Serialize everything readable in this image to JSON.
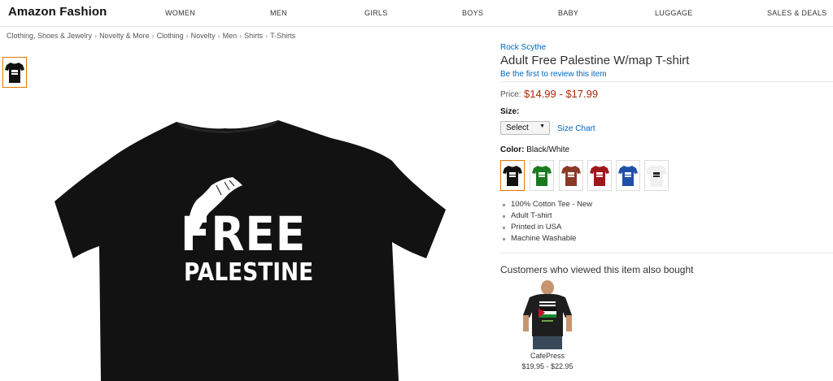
{
  "nav": {
    "brand": "Amazon Fashion",
    "links": [
      "WOMEN",
      "MEN",
      "GIRLS",
      "BOYS",
      "BABY",
      "LUGGAGE",
      "SALES & DEALS"
    ]
  },
  "breadcrumb": [
    "Clothing, Shoes & Jewelry",
    "Novelty & More",
    "Clothing",
    "Novelty",
    "Men",
    "Shirts",
    "T-Shirts"
  ],
  "breadcrumb_separator": "›",
  "product": {
    "brand": "Rock Scythe",
    "title": "Adult Free Palestine W/map T-shirt",
    "review_link": "Be the first to review this item",
    "price_label": "Price:",
    "price": "$14.99 - $17.99",
    "size_label": "Size:",
    "size_selected": "Select",
    "size_chart": "Size Chart",
    "color_label": "Color:",
    "color_value": "Black/White",
    "shirt_text_line1": "FREE",
    "shirt_text_line2": "PALESTINE",
    "swatch_colors": [
      "#111111",
      "#1a7a1f",
      "#8a3a26",
      "#a0161d",
      "#1f4fa8",
      "#f1f1f1"
    ],
    "bullets": [
      "100% Cotton Tee - New",
      "Adult T-shirt",
      "Printed in USA",
      "Machine Washable"
    ]
  },
  "also_bought": {
    "heading": "Customers who viewed this item also bought",
    "item_name": "CafePress",
    "item_price": "$19.95 - $22.95"
  },
  "colors": {
    "link": "#0066c0",
    "price": "#b12704",
    "selected_border": "#e77600"
  }
}
